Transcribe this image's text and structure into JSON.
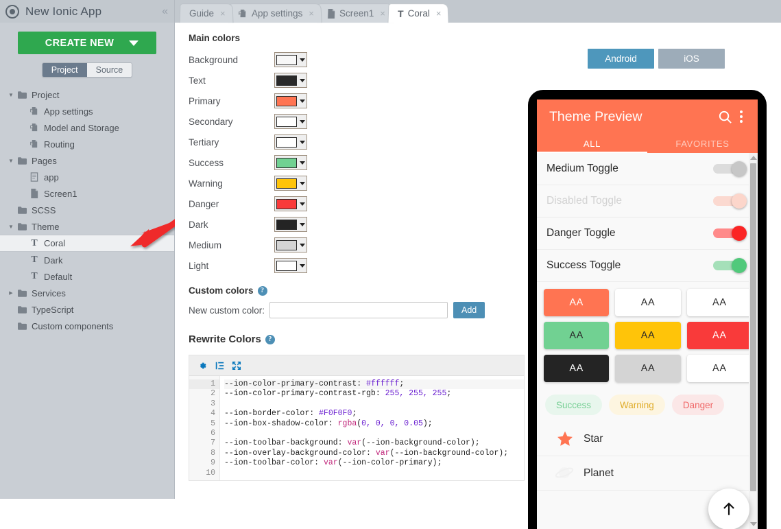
{
  "window": {
    "app_title": "New Ionic App",
    "logo_icon": "ionic-logo-icon",
    "collapse_icon": "«"
  },
  "sidebar": {
    "create_button": "CREATE NEW",
    "segments": [
      {
        "label": "Project",
        "active": true
      },
      {
        "label": "Source",
        "active": false
      }
    ],
    "tree": [
      {
        "label": "Project",
        "icon": "folder-icon",
        "indent": 0,
        "arrow": "down",
        "selected": false
      },
      {
        "label": "App settings",
        "icon": "settings-file-icon",
        "indent": 1,
        "arrow": "none",
        "selected": false
      },
      {
        "label": "Model and Storage",
        "icon": "settings-file-icon",
        "indent": 1,
        "arrow": "none",
        "selected": false
      },
      {
        "label": "Routing",
        "icon": "settings-file-icon",
        "indent": 1,
        "arrow": "none",
        "selected": false
      },
      {
        "label": "Pages",
        "icon": "folder-icon",
        "indent": 0,
        "arrow": "down",
        "selected": false
      },
      {
        "label": "app",
        "icon": "page-icon",
        "indent": 1,
        "arrow": "none",
        "selected": false
      },
      {
        "label": "Screen1",
        "icon": "screen-icon",
        "indent": 1,
        "arrow": "none",
        "selected": false
      },
      {
        "label": "SCSS",
        "icon": "folder-icon",
        "indent": 0,
        "arrow": "none",
        "selected": false
      },
      {
        "label": "Theme",
        "icon": "folder-icon",
        "indent": 0,
        "arrow": "down",
        "selected": false
      },
      {
        "label": "Coral",
        "icon": "theme-t-icon",
        "indent": 1,
        "arrow": "none",
        "selected": true
      },
      {
        "label": "Dark",
        "icon": "theme-t-icon",
        "indent": 1,
        "arrow": "none",
        "selected": false
      },
      {
        "label": "Default",
        "icon": "theme-t-icon",
        "indent": 1,
        "arrow": "none",
        "selected": false
      },
      {
        "label": "Services",
        "icon": "folder-icon",
        "indent": 0,
        "arrow": "right",
        "selected": false
      },
      {
        "label": "TypeScript",
        "icon": "folder-icon",
        "indent": 0,
        "arrow": "none",
        "selected": false
      },
      {
        "label": "Custom components",
        "icon": "folder-icon",
        "indent": 0,
        "arrow": "none",
        "selected": false
      }
    ]
  },
  "tabs": [
    {
      "label": "Guide",
      "icon": "none",
      "active": false,
      "close": "×"
    },
    {
      "label": "App settings",
      "icon": "settings-file-icon",
      "active": false,
      "close": "×"
    },
    {
      "label": "Screen1",
      "icon": "screen-icon",
      "active": false,
      "close": "×"
    },
    {
      "label": "Coral",
      "icon": "theme-t-icon",
      "active": true,
      "close": "×"
    }
  ],
  "editor": {
    "main_colors_title": "Main colors",
    "colors": [
      {
        "name": "Background",
        "value": "#f7f7f7"
      },
      {
        "name": "Text",
        "value": "#2a2a2a"
      },
      {
        "name": "Primary",
        "value": "#ff7452"
      },
      {
        "name": "Secondary",
        "value": "#ffffff"
      },
      {
        "name": "Tertiary",
        "value": "#ffffff"
      },
      {
        "name": "Success",
        "value": "#71d192"
      },
      {
        "name": "Warning",
        "value": "#ffc409"
      },
      {
        "name": "Danger",
        "value": "#f93a3a"
      },
      {
        "name": "Dark",
        "value": "#242424"
      },
      {
        "name": "Medium",
        "value": "#d4d4d4"
      },
      {
        "name": "Light",
        "value": "#ffffff"
      }
    ],
    "custom_colors_title": "Custom colors",
    "custom_color_label": "New custom color:",
    "custom_color_value": "",
    "custom_color_placeholder": "",
    "add_button": "Add",
    "rewrite_colors_title": "Rewrite Colors",
    "help_glyph": "?",
    "toolbar_icons": [
      "gear-icon",
      "indent-icon",
      "fullscreen-icon"
    ],
    "line_numbers": [
      "1",
      "2",
      "3",
      "4",
      "5",
      "6",
      "7",
      "8",
      "9",
      "10"
    ],
    "code_lines": [
      "--ion-color-primary-contrast: #ffffff;",
      "--ion-color-primary-contrast-rgb: 255, 255, 255;",
      "",
      "--ion-border-color: #F0F0F0;",
      "--ion-box-shadow-color: rgba(0, 0, 0, 0.05);",
      "",
      "--ion-toolbar-background: var(--ion-background-color);",
      "--ion-overlay-background-color: var(--ion-background-color);",
      "--ion-toolbar-color: var(--ion-color-primary);",
      ""
    ]
  },
  "preview": {
    "platforms": [
      {
        "label": "Android",
        "active": true
      },
      {
        "label": "iOS",
        "active": false
      }
    ],
    "app_bar_title": "Theme Preview",
    "search_icon": "search-icon",
    "menu_icon": "kebab-menu-icon",
    "tabs": [
      {
        "label": "ALL",
        "active": true
      },
      {
        "label": "FAVORITES",
        "active": false
      }
    ],
    "toggles": [
      {
        "label": "Medium Toggle",
        "on": false,
        "disabled": false,
        "track": "#dcdcdc",
        "knob": "#c7c7c7"
      },
      {
        "label": "Disabled Toggle",
        "on": true,
        "disabled": true,
        "track": "#fbd9d0",
        "knob": "#fcd6cb"
      },
      {
        "label": "Danger Toggle",
        "on": true,
        "disabled": false,
        "track": "#ff8a8a",
        "knob": "#fb2525"
      },
      {
        "label": "Success Toggle",
        "on": true,
        "disabled": false,
        "track": "#a5e0b9",
        "knob": "#51c97b"
      }
    ],
    "buttons": [
      [
        {
          "label": "AA",
          "bg": "#ff7452",
          "fg": "#ffffff"
        },
        {
          "label": "AA",
          "bg": "#ffffff",
          "fg": "#2a2a2a"
        },
        {
          "label": "AA",
          "bg": "#ffffff",
          "fg": "#2a2a2a"
        }
      ],
      [
        {
          "label": "AA",
          "bg": "#71d192",
          "fg": "#2a2a2a"
        },
        {
          "label": "AA",
          "bg": "#ffc409",
          "fg": "#2a2a2a"
        },
        {
          "label": "AA",
          "bg": "#f93a3a",
          "fg": "#ffffff"
        }
      ],
      [
        {
          "label": "AA",
          "bg": "#242424",
          "fg": "#ffffff"
        },
        {
          "label": "AA",
          "bg": "#d4d4d4",
          "fg": "#2a2a2a"
        },
        {
          "label": "AA",
          "bg": "#ffffff",
          "fg": "#2a2a2a"
        }
      ]
    ],
    "chips": [
      {
        "label": "Success",
        "bg": "#e8f6ed",
        "fg": "#77cf95"
      },
      {
        "label": "Warning",
        "bg": "#fdf5e0",
        "fg": "#dfac2a"
      },
      {
        "label": "Danger",
        "bg": "#fbe7e7",
        "fg": "#f06767"
      }
    ],
    "icon_rows": [
      {
        "label": "Star",
        "icon": "star-icon",
        "color": "#ff7452"
      },
      {
        "label": "Planet",
        "icon": "planet-icon",
        "color": "#f2f2f2"
      }
    ],
    "fab_icon": "arrow-up-icon"
  }
}
